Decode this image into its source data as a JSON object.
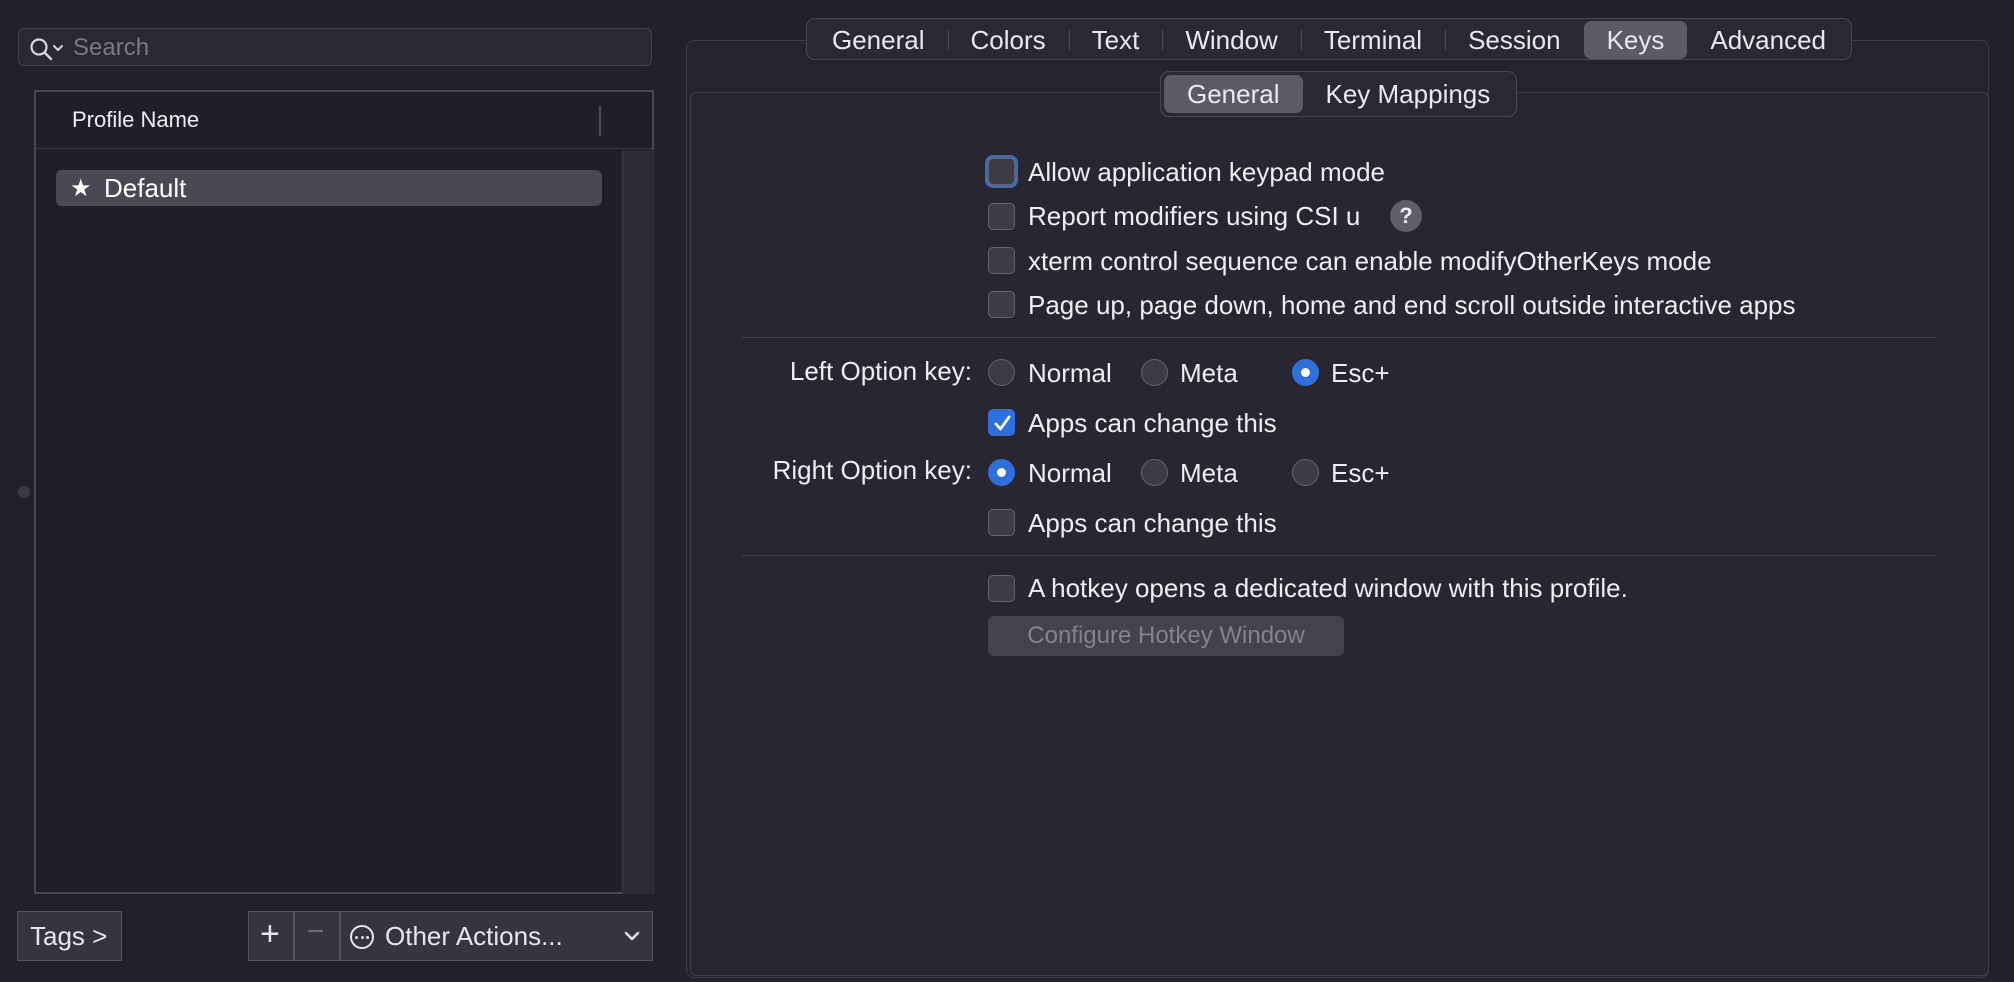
{
  "search": {
    "placeholder": "Search"
  },
  "profiles": {
    "column_header": "Profile Name",
    "items": [
      {
        "name": "Default",
        "is_default": true
      }
    ]
  },
  "bottom_bar": {
    "tags_label": "Tags >",
    "add_label": "+",
    "remove_label": "−",
    "other_actions_label": "Other Actions..."
  },
  "tabs": {
    "items": [
      "General",
      "Colors",
      "Text",
      "Window",
      "Terminal",
      "Session",
      "Keys",
      "Advanced"
    ],
    "selected": "Keys"
  },
  "subtabs": {
    "items": [
      "General",
      "Key Mappings"
    ],
    "selected": "General"
  },
  "keys": {
    "options": [
      {
        "label": "Allow application keypad mode",
        "checked": false
      },
      {
        "label": "Report modifiers using CSI u",
        "checked": false
      },
      {
        "label": "xterm control sequence can enable modifyOtherKeys mode",
        "checked": false
      },
      {
        "label": "Page up, page down, home and end scroll outside interactive apps",
        "checked": false
      }
    ],
    "help_label": "?",
    "left_option": {
      "label": "Left Option key:",
      "choices": [
        "Normal",
        "Meta",
        "Esc+"
      ],
      "selected": "Esc+",
      "apps_can_change": {
        "label": "Apps can change this",
        "checked": true
      }
    },
    "right_option": {
      "label": "Right Option key:",
      "choices": [
        "Normal",
        "Meta",
        "Esc+"
      ],
      "selected": "Normal",
      "apps_can_change": {
        "label": "Apps can change this",
        "checked": false
      }
    },
    "hotkey": {
      "label": "A hotkey opens a dedicated window with this profile.",
      "checked": false,
      "button_label": "Configure Hotkey Window",
      "button_enabled": false
    }
  },
  "colors": {
    "accent": "#2f6fdc",
    "background": "#22202b"
  }
}
